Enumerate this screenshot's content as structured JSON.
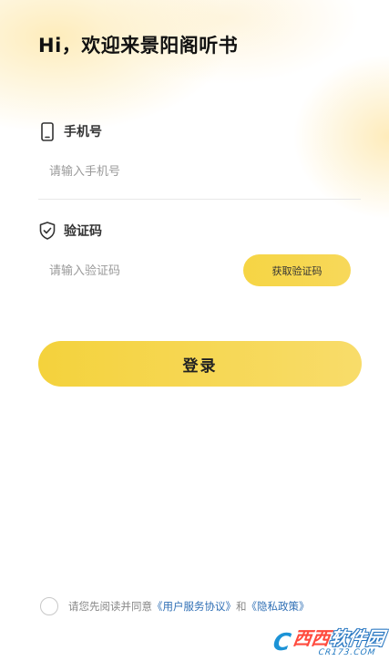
{
  "greeting": "Hi，欢迎来景阳阁听书",
  "phone": {
    "label": "手机号",
    "icon": "phone-icon",
    "placeholder": "请输入手机号"
  },
  "code": {
    "label": "验证码",
    "icon": "shield-check-icon",
    "placeholder": "请输入验证码",
    "get_code_label": "获取验证码"
  },
  "login_label": "登录",
  "agreement": {
    "prefix": "请您先阅读并同意",
    "user_agreement": "《用户服务协议》",
    "conjunction": "和",
    "privacy_policy": "《隐私政策》"
  },
  "watermark": {
    "main_left": "西西",
    "main_right": "软件园",
    "sub": "CR173.COM"
  },
  "colors": {
    "accent": "#f5d441",
    "link": "#2f6fb5",
    "placeholder": "#9a9a9a"
  }
}
